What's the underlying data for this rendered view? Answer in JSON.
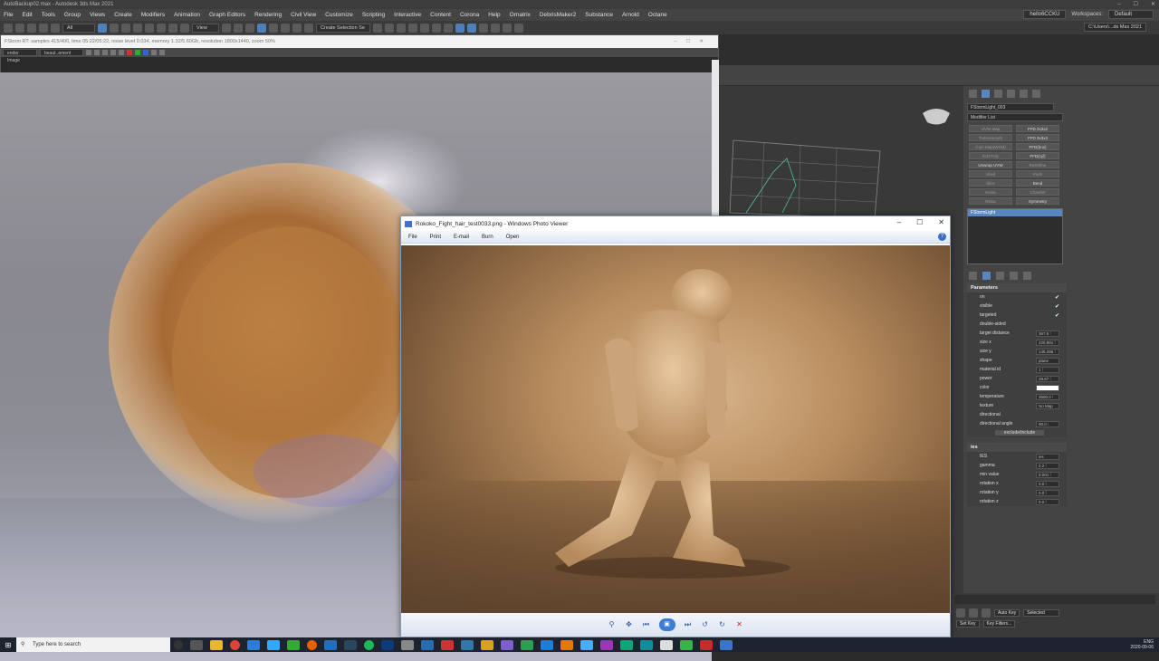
{
  "max_window": {
    "title": "AutoBackup02.max - Autodesk 3ds Max 2021",
    "menus": [
      "File",
      "Edit",
      "Tools",
      "Group",
      "Views",
      "Create",
      "Modifiers",
      "Animation",
      "Graph Editors",
      "Rendering",
      "Civil View",
      "Customize",
      "Scripting",
      "Interactive",
      "Content",
      "Corona",
      "Help",
      "Ornatrix",
      "DebrisMaker2",
      "Substance",
      "Arnold",
      "Octane"
    ],
    "user": "hello6CCKU",
    "workspaces_label": "Workspaces:",
    "workspace": "Default",
    "path": "C:\\Users\\...ds Max 2021",
    "selection_set": "Create Selection Se",
    "view_dropdown": "All",
    "view_mode": "View"
  },
  "render_window": {
    "title": "FStorm RT: samples 415/400, time 05:22/05:22, noise level 0.034, memory 1.32/5.60Gb, resolution 1800x1440, zoom 50%",
    "area_label": "ender Image",
    "preset": "beaut..ament"
  },
  "photo_viewer": {
    "title": "Rokoko_Fight_hair_test0033.png - Windows Photo Viewer",
    "menu": [
      "File",
      "Print",
      "E-mail",
      "Burn",
      "Open"
    ],
    "help": "?"
  },
  "command_panel": {
    "object_name": "FStormLight_003",
    "modifier_list": "Modifier List",
    "modifiers": [
      "UVW Map",
      "FFD 2x2x2",
      "Turbosmooth",
      "FFD 3x3x3",
      "Cam Map(WSM)",
      "FFD(box)",
      "Edit Poly",
      "FFD(cyl)",
      "Unwrap UVW",
      "ReDefine",
      "Shell",
      "Push",
      "Slice",
      "Bend",
      "Noise",
      "Chamfer",
      "Relax",
      "Symmetry"
    ],
    "stack_item": "FStormLight",
    "parameters_title": "Parameters",
    "params": [
      {
        "label": "on",
        "value": "✔",
        "type": "check"
      },
      {
        "label": "visible",
        "value": "✔",
        "type": "check"
      },
      {
        "label": "targeted",
        "value": "✔",
        "type": "check"
      },
      {
        "label": "double-sided",
        "value": "",
        "type": "check"
      },
      {
        "label": "target distance",
        "value": "367.5 ⁞",
        "type": "spin"
      },
      {
        "label": "size x",
        "value": "220.891 ⁞",
        "type": "spin"
      },
      {
        "label": "size y",
        "value": "145.298 ⁞",
        "type": "spin"
      },
      {
        "label": "shape",
        "value": "plane",
        "type": "spin"
      },
      {
        "label": "material id",
        "value": "1 ⁞",
        "type": "spin"
      },
      {
        "label": "power",
        "value": "28.67 ⁞",
        "type": "spin"
      },
      {
        "label": "color",
        "value": "",
        "type": "spin"
      },
      {
        "label": "temperature",
        "value": "3500.0 ⁞",
        "type": "spin"
      },
      {
        "label": "texture",
        "value": "No Map",
        "type": "spin"
      },
      {
        "label": "directional",
        "value": "",
        "type": "check"
      },
      {
        "label": "directional angle",
        "value": "90.0 ⁞",
        "type": "spin"
      },
      {
        "label": "exclude/include",
        "value": "",
        "type": "button"
      }
    ],
    "ies_title": "ies",
    "ies_params": [
      {
        "label": "IES",
        "value": "ies"
      },
      {
        "label": "gamma",
        "value": "2.2 ⁞"
      },
      {
        "label": "min value",
        "value": "0.001 ⁞"
      },
      {
        "label": "rotation x",
        "value": "0.0 ⁞"
      },
      {
        "label": "rotation y",
        "value": "0.0 ⁞"
      },
      {
        "label": "rotation z",
        "value": "0.0 ⁞"
      }
    ]
  },
  "timeline": {
    "auto_key": "Auto Key",
    "set_key": "Set Key",
    "selected": "Selected",
    "key_filters": "Key Filters..."
  },
  "taskbar": {
    "search_placeholder": "Type here to search",
    "lang": "ENG",
    "date": "2020-09-06"
  }
}
